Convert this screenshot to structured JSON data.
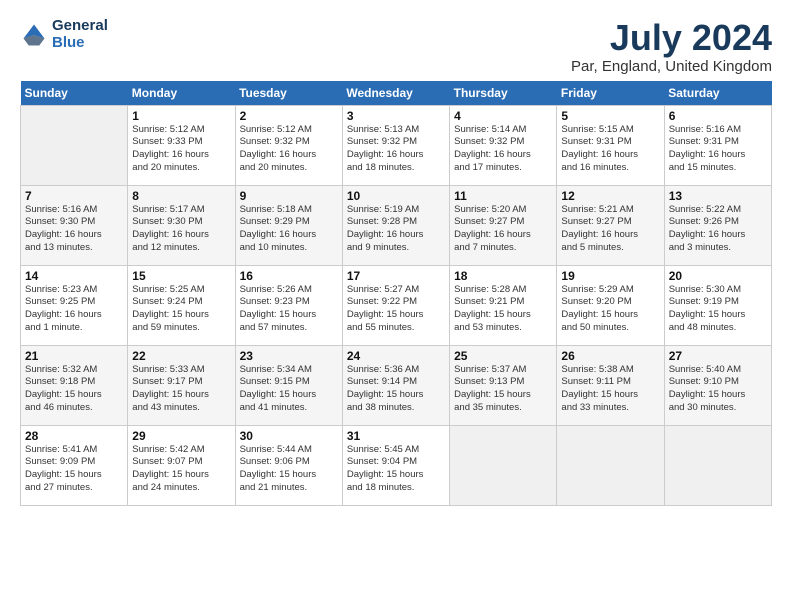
{
  "header": {
    "logo_line1": "General",
    "logo_line2": "Blue",
    "title": "July 2024",
    "subtitle": "Par, England, United Kingdom"
  },
  "weekdays": [
    "Sunday",
    "Monday",
    "Tuesday",
    "Wednesday",
    "Thursday",
    "Friday",
    "Saturday"
  ],
  "weeks": [
    [
      {
        "day": "",
        "info": ""
      },
      {
        "day": "1",
        "info": "Sunrise: 5:12 AM\nSunset: 9:33 PM\nDaylight: 16 hours\nand 20 minutes."
      },
      {
        "day": "2",
        "info": "Sunrise: 5:12 AM\nSunset: 9:32 PM\nDaylight: 16 hours\nand 20 minutes."
      },
      {
        "day": "3",
        "info": "Sunrise: 5:13 AM\nSunset: 9:32 PM\nDaylight: 16 hours\nand 18 minutes."
      },
      {
        "day": "4",
        "info": "Sunrise: 5:14 AM\nSunset: 9:32 PM\nDaylight: 16 hours\nand 17 minutes."
      },
      {
        "day": "5",
        "info": "Sunrise: 5:15 AM\nSunset: 9:31 PM\nDaylight: 16 hours\nand 16 minutes."
      },
      {
        "day": "6",
        "info": "Sunrise: 5:16 AM\nSunset: 9:31 PM\nDaylight: 16 hours\nand 15 minutes."
      }
    ],
    [
      {
        "day": "7",
        "info": "Sunrise: 5:16 AM\nSunset: 9:30 PM\nDaylight: 16 hours\nand 13 minutes."
      },
      {
        "day": "8",
        "info": "Sunrise: 5:17 AM\nSunset: 9:30 PM\nDaylight: 16 hours\nand 12 minutes."
      },
      {
        "day": "9",
        "info": "Sunrise: 5:18 AM\nSunset: 9:29 PM\nDaylight: 16 hours\nand 10 minutes."
      },
      {
        "day": "10",
        "info": "Sunrise: 5:19 AM\nSunset: 9:28 PM\nDaylight: 16 hours\nand 9 minutes."
      },
      {
        "day": "11",
        "info": "Sunrise: 5:20 AM\nSunset: 9:27 PM\nDaylight: 16 hours\nand 7 minutes."
      },
      {
        "day": "12",
        "info": "Sunrise: 5:21 AM\nSunset: 9:27 PM\nDaylight: 16 hours\nand 5 minutes."
      },
      {
        "day": "13",
        "info": "Sunrise: 5:22 AM\nSunset: 9:26 PM\nDaylight: 16 hours\nand 3 minutes."
      }
    ],
    [
      {
        "day": "14",
        "info": "Sunrise: 5:23 AM\nSunset: 9:25 PM\nDaylight: 16 hours\nand 1 minute."
      },
      {
        "day": "15",
        "info": "Sunrise: 5:25 AM\nSunset: 9:24 PM\nDaylight: 15 hours\nand 59 minutes."
      },
      {
        "day": "16",
        "info": "Sunrise: 5:26 AM\nSunset: 9:23 PM\nDaylight: 15 hours\nand 57 minutes."
      },
      {
        "day": "17",
        "info": "Sunrise: 5:27 AM\nSunset: 9:22 PM\nDaylight: 15 hours\nand 55 minutes."
      },
      {
        "day": "18",
        "info": "Sunrise: 5:28 AM\nSunset: 9:21 PM\nDaylight: 15 hours\nand 53 minutes."
      },
      {
        "day": "19",
        "info": "Sunrise: 5:29 AM\nSunset: 9:20 PM\nDaylight: 15 hours\nand 50 minutes."
      },
      {
        "day": "20",
        "info": "Sunrise: 5:30 AM\nSunset: 9:19 PM\nDaylight: 15 hours\nand 48 minutes."
      }
    ],
    [
      {
        "day": "21",
        "info": "Sunrise: 5:32 AM\nSunset: 9:18 PM\nDaylight: 15 hours\nand 46 minutes."
      },
      {
        "day": "22",
        "info": "Sunrise: 5:33 AM\nSunset: 9:17 PM\nDaylight: 15 hours\nand 43 minutes."
      },
      {
        "day": "23",
        "info": "Sunrise: 5:34 AM\nSunset: 9:15 PM\nDaylight: 15 hours\nand 41 minutes."
      },
      {
        "day": "24",
        "info": "Sunrise: 5:36 AM\nSunset: 9:14 PM\nDaylight: 15 hours\nand 38 minutes."
      },
      {
        "day": "25",
        "info": "Sunrise: 5:37 AM\nSunset: 9:13 PM\nDaylight: 15 hours\nand 35 minutes."
      },
      {
        "day": "26",
        "info": "Sunrise: 5:38 AM\nSunset: 9:11 PM\nDaylight: 15 hours\nand 33 minutes."
      },
      {
        "day": "27",
        "info": "Sunrise: 5:40 AM\nSunset: 9:10 PM\nDaylight: 15 hours\nand 30 minutes."
      }
    ],
    [
      {
        "day": "28",
        "info": "Sunrise: 5:41 AM\nSunset: 9:09 PM\nDaylight: 15 hours\nand 27 minutes."
      },
      {
        "day": "29",
        "info": "Sunrise: 5:42 AM\nSunset: 9:07 PM\nDaylight: 15 hours\nand 24 minutes."
      },
      {
        "day": "30",
        "info": "Sunrise: 5:44 AM\nSunset: 9:06 PM\nDaylight: 15 hours\nand 21 minutes."
      },
      {
        "day": "31",
        "info": "Sunrise: 5:45 AM\nSunset: 9:04 PM\nDaylight: 15 hours\nand 18 minutes."
      },
      {
        "day": "",
        "info": ""
      },
      {
        "day": "",
        "info": ""
      },
      {
        "day": "",
        "info": ""
      }
    ]
  ]
}
